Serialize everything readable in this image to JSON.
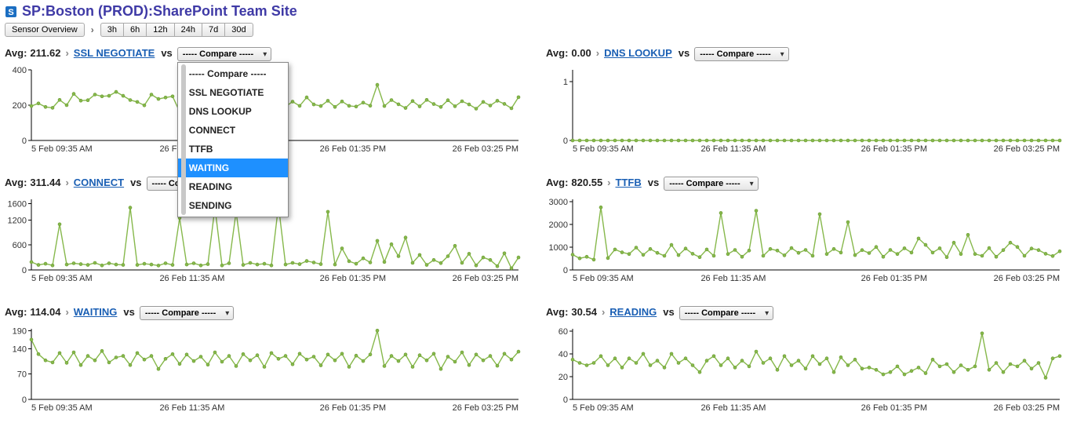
{
  "page": {
    "title": "SP:Boston (PROD):SharePoint Team Site"
  },
  "toolbar": {
    "overview_label": "Sensor Overview",
    "ranges": [
      "3h",
      "6h",
      "12h",
      "24h",
      "7d",
      "30d"
    ]
  },
  "compare": {
    "placeholder": "----- Compare -----",
    "options": [
      "----- Compare -----",
      "SSL NEGOTIATE",
      "DNS LOOKUP",
      "CONNECT",
      "TTFB",
      "WAITING",
      "READING",
      "SENDING"
    ],
    "highlighted": "WAITING"
  },
  "x_axis_labels": [
    "5 Feb 09:35 AM",
    "26 Feb 11:35 AM",
    "26 Feb 01:35 PM",
    "26 Feb 03:25 PM"
  ],
  "panels": [
    {
      "id": "ssl",
      "metric": "SSL NEGOTIATE",
      "avg": "211.62",
      "y_ticks": [
        0,
        200,
        400
      ],
      "ylim": [
        0,
        400
      ],
      "dropdown_open": true
    },
    {
      "id": "dns",
      "metric": "DNS LOOKUP",
      "avg": "0.00",
      "y_ticks": [
        0,
        1
      ],
      "ylim": [
        0,
        1.2
      ]
    },
    {
      "id": "connect",
      "metric": "CONNECT",
      "avg": "311.44",
      "y_ticks": [
        0,
        600,
        1200,
        1600
      ],
      "ylim": [
        0,
        1700
      ]
    },
    {
      "id": "ttfb",
      "metric": "TTFB",
      "avg": "820.55",
      "y_ticks": [
        0,
        1000,
        2000,
        3000
      ],
      "ylim": [
        0,
        3100
      ]
    },
    {
      "id": "waiting",
      "metric": "WAITING",
      "avg": "114.04",
      "y_ticks": [
        0,
        70,
        140,
        190
      ],
      "ylim": [
        0,
        195
      ]
    },
    {
      "id": "reading",
      "metric": "READING",
      "avg": "30.54",
      "y_ticks": [
        0,
        20,
        40,
        60
      ],
      "ylim": [
        0,
        62
      ]
    }
  ],
  "labels": {
    "avg": "Avg:",
    "vs": "vs"
  },
  "chart_data": [
    {
      "id": "ssl",
      "type": "line",
      "title": "SSL NEGOTIATE",
      "xlabel": "",
      "ylabel": "",
      "ylim": [
        0,
        400
      ],
      "x_ticks": [
        "5 Feb 09:35 AM",
        "26 Feb 11:35 AM",
        "26 Feb 01:35 PM",
        "26 Feb 03:25 PM"
      ],
      "values": [
        195,
        210,
        190,
        185,
        230,
        200,
        264,
        226,
        228,
        260,
        250,
        253,
        275,
        253,
        229,
        218,
        199,
        260,
        235,
        243,
        250,
        163,
        235,
        236,
        213,
        210,
        191,
        225,
        205,
        241,
        220,
        193,
        211,
        189,
        229,
        210,
        192,
        220,
        196,
        244,
        204,
        195,
        225,
        190,
        221,
        196,
        192,
        214,
        197,
        315,
        195,
        229,
        205,
        184,
        223,
        193,
        230,
        206,
        190,
        228,
        194,
        222,
        204,
        180,
        218,
        198,
        225,
        207,
        182,
        245
      ]
    },
    {
      "id": "dns",
      "type": "line",
      "title": "DNS LOOKUP",
      "xlabel": "",
      "ylabel": "",
      "ylim": [
        0,
        1.2
      ],
      "x_ticks": [
        "5 Feb 09:35 AM",
        "26 Feb 11:35 AM",
        "26 Feb 01:35 PM",
        "26 Feb 03:25 PM"
      ],
      "values": [
        0,
        0,
        0,
        0,
        0,
        0,
        0,
        0,
        0,
        0,
        0,
        0,
        0,
        0,
        0,
        0,
        0,
        0,
        0,
        0,
        0,
        0,
        0,
        0,
        0,
        0,
        0,
        0,
        0,
        0,
        0,
        0,
        0,
        0,
        0,
        0,
        0,
        0,
        0,
        0,
        0,
        0,
        0,
        0,
        0,
        0,
        0,
        0,
        0,
        0,
        0,
        0,
        0,
        0,
        0,
        0,
        0,
        0,
        0,
        0,
        0,
        0,
        0,
        0,
        0,
        0,
        0,
        0,
        0,
        0
      ]
    },
    {
      "id": "connect",
      "type": "line",
      "title": "CONNECT",
      "xlabel": "",
      "ylabel": "",
      "ylim": [
        0,
        1700
      ],
      "x_ticks": [
        "5 Feb 09:35 AM",
        "26 Feb 11:35 AM",
        "26 Feb 01:35 PM",
        "26 Feb 03:25 PM"
      ],
      "values": [
        190,
        120,
        150,
        110,
        1100,
        130,
        160,
        140,
        120,
        170,
        110,
        160,
        130,
        120,
        1500,
        120,
        150,
        130,
        105,
        160,
        120,
        1250,
        130,
        160,
        110,
        140,
        1500,
        110,
        160,
        1400,
        120,
        170,
        130,
        150,
        110,
        1550,
        130,
        170,
        140,
        215,
        180,
        140,
        1400,
        130,
        520,
        210,
        150,
        280,
        180,
        700,
        190,
        620,
        330,
        780,
        170,
        360,
        120,
        240,
        165,
        330,
        580,
        170,
        390,
        110,
        300,
        240,
        90,
        400,
        40,
        300
      ]
    },
    {
      "id": "ttfb",
      "type": "line",
      "title": "TTFB",
      "xlabel": "",
      "ylabel": "",
      "ylim": [
        0,
        3100
      ],
      "x_ticks": [
        "5 Feb 09:35 AM",
        "26 Feb 11:35 AM",
        "26 Feb 01:35 PM",
        "26 Feb 03:25 PM"
      ],
      "values": [
        670,
        510,
        580,
        450,
        2750,
        520,
        900,
        770,
        700,
        980,
        660,
        920,
        750,
        620,
        1100,
        650,
        940,
        710,
        560,
        900,
        620,
        2500,
        700,
        880,
        580,
        850,
        2600,
        620,
        920,
        850,
        640,
        960,
        750,
        880,
        620,
        2450,
        700,
        920,
        760,
        2100,
        650,
        870,
        740,
        1010,
        580,
        880,
        700,
        950,
        760,
        1380,
        1100,
        760,
        950,
        560,
        1200,
        700,
        1540,
        700,
        620,
        960,
        580,
        870,
        1200,
        1010,
        620,
        940,
        870,
        710,
        610,
        820
      ]
    },
    {
      "id": "waiting",
      "type": "line",
      "title": "WAITING",
      "xlabel": "",
      "ylabel": "",
      "ylim": [
        0,
        195
      ],
      "x_ticks": [
        "5 Feb 09:35 AM",
        "26 Feb 11:35 AM",
        "26 Feb 01:35 PM",
        "26 Feb 03:25 PM"
      ],
      "values": [
        165,
        125,
        108,
        102,
        128,
        101,
        130,
        95,
        120,
        108,
        134,
        102,
        116,
        120,
        95,
        128,
        110,
        120,
        84,
        112,
        125,
        98,
        124,
        106,
        118,
        96,
        130,
        104,
        120,
        92,
        125,
        108,
        122,
        90,
        128,
        112,
        120,
        97,
        126,
        110,
        118,
        94,
        124,
        108,
        126,
        90,
        121,
        106,
        124,
        190,
        92,
        120,
        106,
        124,
        90,
        122,
        108,
        126,
        84,
        118,
        104,
        130,
        95,
        124,
        108,
        120,
        93,
        126,
        110,
        132
      ]
    },
    {
      "id": "reading",
      "type": "line",
      "title": "READING",
      "xlabel": "",
      "ylabel": "",
      "ylim": [
        0,
        62
      ],
      "x_ticks": [
        "5 Feb 09:35 AM",
        "26 Feb 11:35 AM",
        "26 Feb 01:35 PM",
        "26 Feb 03:25 PM"
      ],
      "values": [
        35,
        32,
        30,
        32,
        38,
        30,
        36,
        28,
        36,
        32,
        40,
        30,
        34,
        28,
        40,
        32,
        36,
        30,
        24,
        34,
        38,
        30,
        36,
        28,
        34,
        29,
        42,
        32,
        36,
        26,
        38,
        30,
        34,
        27,
        38,
        31,
        36,
        24,
        37,
        30,
        35,
        27,
        28,
        26,
        22,
        24,
        29,
        22,
        25,
        28,
        23,
        35,
        29,
        31,
        24,
        30,
        26,
        29,
        58,
        26,
        32,
        24,
        31,
        29,
        34,
        27,
        32,
        19,
        36,
        38
      ]
    }
  ]
}
